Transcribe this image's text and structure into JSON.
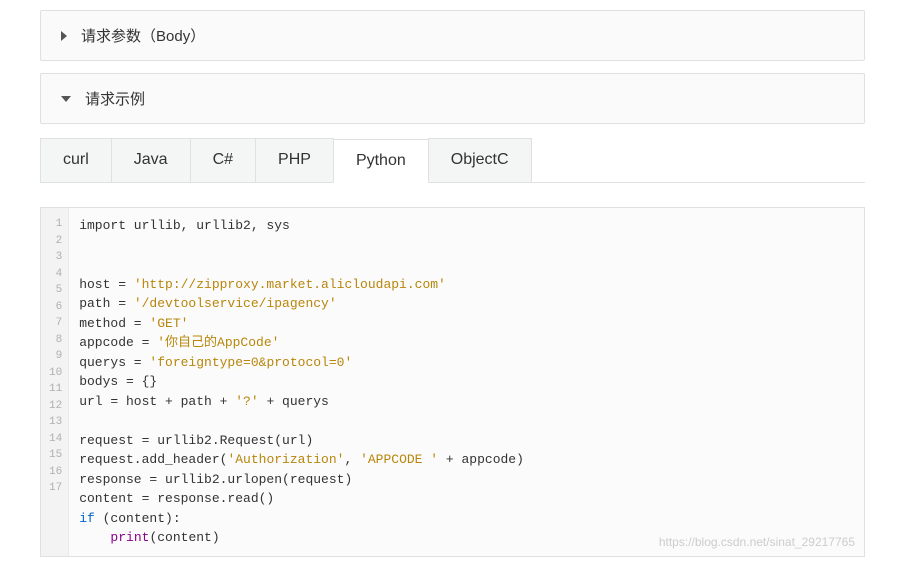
{
  "panels": {
    "body": {
      "title": "请求参数（Body）"
    },
    "example": {
      "title": "请求示例"
    }
  },
  "tabs": [
    {
      "label": "curl"
    },
    {
      "label": "Java"
    },
    {
      "label": "C#"
    },
    {
      "label": "PHP"
    },
    {
      "label": "Python",
      "active": true
    },
    {
      "label": "ObjectC"
    }
  ],
  "gutter": "1\n2\n3\n4\n5\n6\n7\n8\n9\n10\n11\n12\n13\n14\n15\n16\n17",
  "code": {
    "l1": "import urllib, urllib2, sys",
    "l2": "",
    "l3": "",
    "l4a": "host = ",
    "l4s": "'http://zipproxy.market.alicloudapi.com'",
    "l5a": "path = ",
    "l5s": "'/devtoolservice/ipagency'",
    "l6a": "method = ",
    "l6s": "'GET'",
    "l7a": "appcode = ",
    "l7s": "'你自己的AppCode'",
    "l8a": "querys = ",
    "l8s": "'foreigntype=0&protocol=0'",
    "l9": "bodys = {}",
    "l10a": "url = host + path + ",
    "l10s": "'?'",
    "l10b": " + querys",
    "l11": "",
    "l12": "request = urllib2.Request(url)",
    "l13a": "request.add_header(",
    "l13s1": "'Authorization'",
    "l13m": ", ",
    "l13s2": "'APPCODE '",
    "l13b": " + appcode)",
    "l14": "response = urllib2.urlopen(request)",
    "l15": "content = response.read()",
    "l16kw": "if",
    "l16b": " (content):",
    "l17sp": "    ",
    "l17fn": "print",
    "l17b": "(content)"
  },
  "watermark": "https://blog.csdn.net/sinat_29217765"
}
